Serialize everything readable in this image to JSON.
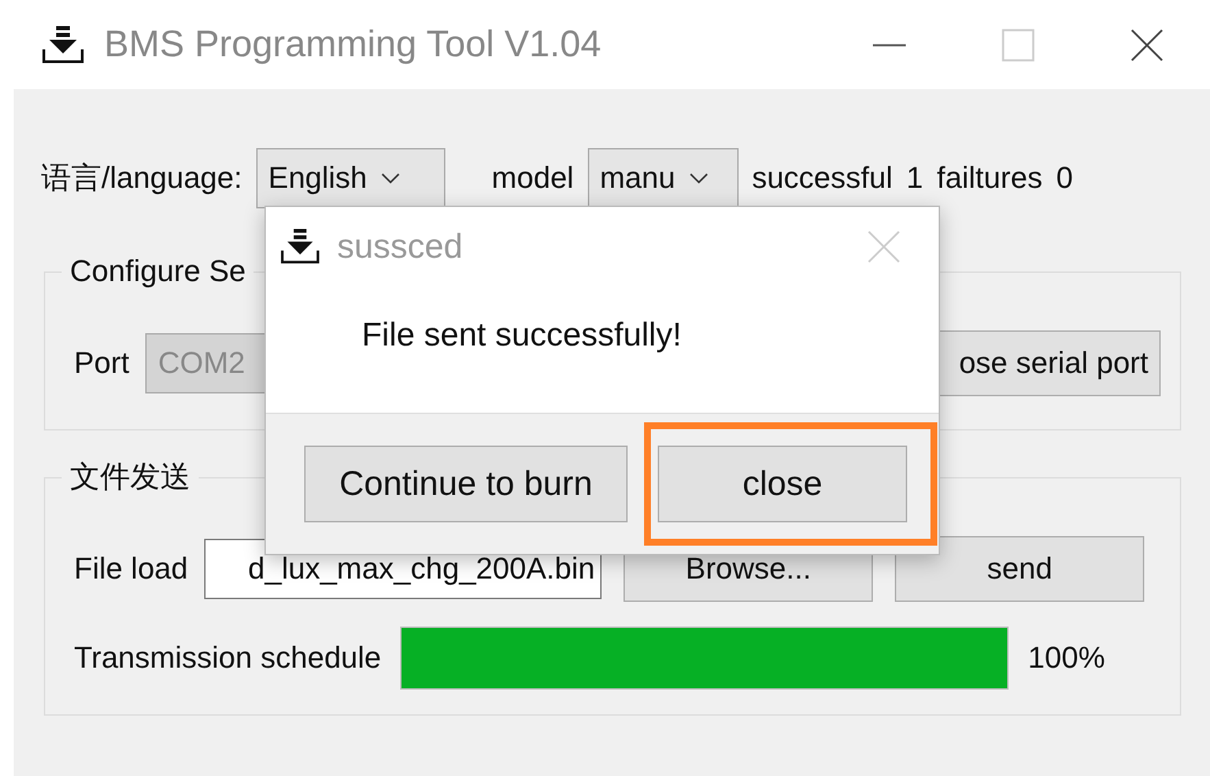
{
  "window": {
    "title": "BMS Programming Tool V1.04"
  },
  "language_row": {
    "label": "语言/language:",
    "language": "English",
    "model_label": "model",
    "model": "manu",
    "successful_label": "successful",
    "successful": "1",
    "failures_label": "failtures",
    "failures": "0"
  },
  "serial_group": {
    "title": "Configure Se",
    "port_label": "Port",
    "port": "COM2",
    "port_disabled": true,
    "button": "ose serial port"
  },
  "file_group": {
    "title": "文件发送",
    "file_label": "File load",
    "file": "d_lux_max_chg_200A.bin",
    "browse": "Browse...",
    "send": "send",
    "progress_label": "Transmission schedule",
    "progress": {
      "level": 1.0
    },
    "progress_reading": "100%"
  },
  "dialog": {
    "title": "sussced",
    "message": "File sent successfully!",
    "buttons": [
      {
        "label": "Continue to burn",
        "highlighted": false
      },
      {
        "label": "close",
        "highlighted": true
      }
    ]
  }
}
